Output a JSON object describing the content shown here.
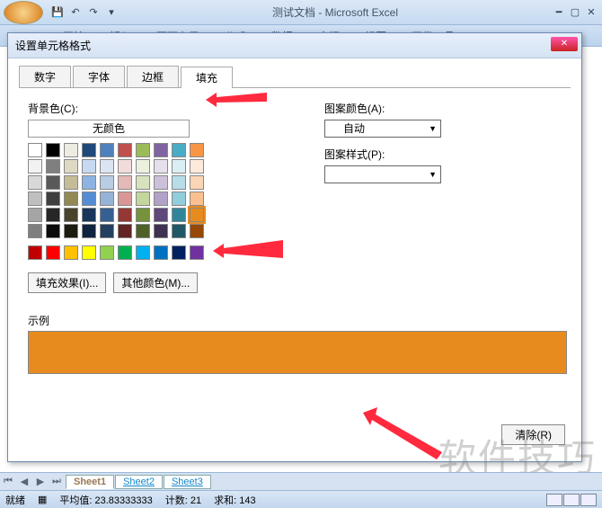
{
  "window": {
    "title": "测试文档 - Microsoft Excel"
  },
  "ribbon": {
    "tabs": [
      "开始",
      "插入",
      "页面布局",
      "公式",
      "数据",
      "审阅",
      "视图",
      "开发工具"
    ]
  },
  "dialog": {
    "title": "设置单元格格式",
    "tabs": {
      "t0": "数字",
      "t1": "字体",
      "t2": "边框",
      "t3": "填充"
    },
    "bg_label": "背景色(C):",
    "nocolor": "无颜色",
    "pattern_color_label": "图案颜色(A):",
    "pattern_color_value": "自动",
    "pattern_style_label": "图案样式(P):",
    "fill_effects": "填充效果(I)...",
    "other_colors": "其他颜色(M)...",
    "sample_label": "示例",
    "clear": "清除(R)"
  },
  "theme_colors": [
    "#ffffff",
    "#000000",
    "#eeece1",
    "#1f497d",
    "#4f81bd",
    "#c0504d",
    "#9bbb59",
    "#8064a2",
    "#4bacc6",
    "#f79646",
    "#f2f2f2",
    "#7f7f7f",
    "#ddd9c3",
    "#c6d9f0",
    "#dbe5f1",
    "#f2dcdb",
    "#ebf1dd",
    "#e5e0ec",
    "#dbeef3",
    "#fdeada",
    "#d8d8d8",
    "#595959",
    "#c4bd97",
    "#8db3e2",
    "#b8cce4",
    "#e5b9b7",
    "#d7e3bc",
    "#ccc1d9",
    "#b7dde8",
    "#fbd5b5",
    "#bfbfbf",
    "#3f3f3f",
    "#938953",
    "#548dd4",
    "#95b3d7",
    "#d99694",
    "#c3d69b",
    "#b2a2c7",
    "#92cddc",
    "#fac08f",
    "#a5a5a5",
    "#262626",
    "#494429",
    "#17365d",
    "#366092",
    "#953734",
    "#76923c",
    "#5f497a",
    "#31859b",
    "#e36c09",
    "#7f7f7f",
    "#0c0c0c",
    "#1d1b10",
    "#0f243e",
    "#244061",
    "#632423",
    "#4f6128",
    "#3f3151",
    "#205867",
    "#974806"
  ],
  "standard_colors": [
    "#c00000",
    "#ff0000",
    "#ffc000",
    "#ffff00",
    "#92d050",
    "#00b050",
    "#00b0f0",
    "#0070c0",
    "#002060",
    "#7030a0"
  ],
  "selected_color": "#e88b1f",
  "sheets": {
    "s1": "Sheet1",
    "s2": "Sheet2",
    "s3": "Sheet3"
  },
  "status": {
    "ready": "就绪",
    "avg": "平均值: 23.83333333",
    "count": "计数: 21",
    "sum": "求和: 143"
  },
  "watermark": "软件技巧"
}
